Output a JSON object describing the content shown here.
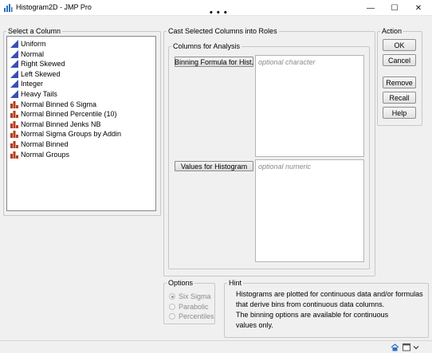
{
  "window": {
    "title": "Histogram2D - JMP Pro",
    "minimize_glyph": "—",
    "maximize_glyph": "☐",
    "close_glyph": "✕",
    "drag_handle": "• • •"
  },
  "select_column": {
    "legend": "Select a Column",
    "items": [
      {
        "label": "Uniform",
        "icon": "continuous-icon"
      },
      {
        "label": "Normal",
        "icon": "continuous-icon"
      },
      {
        "label": "Right Skewed",
        "icon": "continuous-icon"
      },
      {
        "label": "Left Skewed",
        "icon": "continuous-icon"
      },
      {
        "label": "Integer",
        "icon": "continuous-icon"
      },
      {
        "label": "Heavy Tails",
        "icon": "continuous-icon"
      },
      {
        "label": "Normal Binned 6 Sigma",
        "icon": "ordinal-icon"
      },
      {
        "label": "Normal Binned Percentile (10)",
        "icon": "ordinal-icon"
      },
      {
        "label": "Normal Binned Jenks NB",
        "icon": "ordinal-icon"
      },
      {
        "label": "Normal Sigma Groups by Addin",
        "icon": "ordinal-icon"
      },
      {
        "label": "Normal Binned",
        "icon": "ordinal-icon"
      },
      {
        "label": "Normal Groups",
        "icon": "ordinal-icon"
      }
    ]
  },
  "cast": {
    "legend": "Cast Selected Columns into Roles",
    "analysis_legend": "Columns for Analysis",
    "binning_button": "Binning Formula for Hist.",
    "binning_placeholder": "optional character",
    "values_button": "Values for Histogram",
    "values_placeholder": "optional numeric"
  },
  "action": {
    "legend": "Action",
    "ok": "OK",
    "cancel": "Cancel",
    "remove": "Remove",
    "recall": "Recall",
    "help": "Help"
  },
  "options": {
    "legend": "Options",
    "radios": [
      {
        "label": "Six Sigma",
        "checked": true
      },
      {
        "label": "Parabolic",
        "checked": false
      },
      {
        "label": "Percentiles",
        "checked": false
      }
    ]
  },
  "hint": {
    "legend": "Hint",
    "lines": [
      "Histograms are plotted for continuous data and/or formulas",
      "that derive bins from continuous data columns.",
      "The binning options are available for continuous",
      "values only."
    ]
  },
  "colors": {
    "continuous_icon": "#3b4fb0",
    "ordinal_icon": "#b3401f",
    "accent": "#0067c0"
  }
}
